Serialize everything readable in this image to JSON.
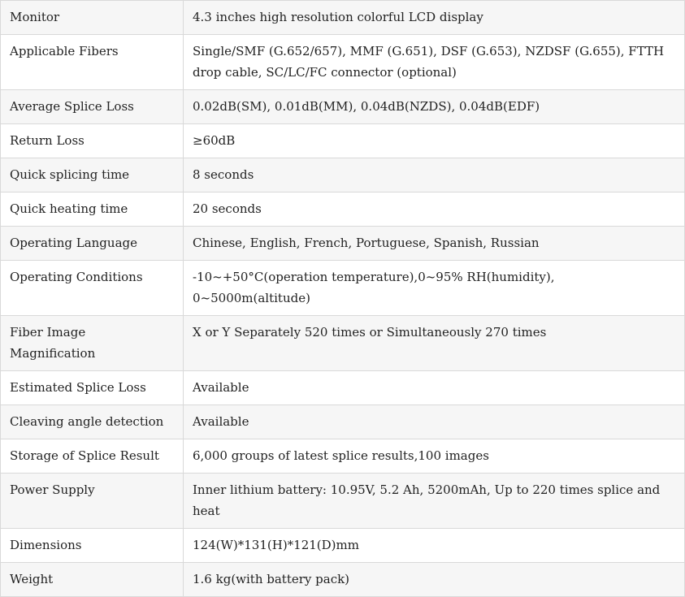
{
  "spec_table": {
    "rows": [
      {
        "label": "Monitor",
        "value": "4.3 inches high resolution colorful LCD display"
      },
      {
        "label": "Applicable Fibers",
        "value": "Single/SMF (G.652/657), MMF (G.651), DSF (G.653), NZDSF (G.655), FTTH drop cable, SC/LC/FC connector (optional)"
      },
      {
        "label": "Average Splice Loss",
        "value": "0.02dB(SM), 0.01dB(MM), 0.04dB(NZDS), 0.04dB(EDF)"
      },
      {
        "label": "Return Loss",
        "value": "≥60dB"
      },
      {
        "label": "Quick splicing time",
        "value": "8 seconds"
      },
      {
        "label": "Quick heating time",
        "value": "20 seconds"
      },
      {
        "label": "Operating Language",
        "value": "Chinese, English, French, Portuguese, Spanish, Russian"
      },
      {
        "label": "Operating Conditions",
        "value": "-10~+50°C(operation temperature),0~95% RH(humidity), 0~5000m(altitude)"
      },
      {
        "label": "Fiber Image Magnification",
        "value": "X or Y Separately 520 times or Simultaneously 270 times"
      },
      {
        "label": "Estimated Splice Loss",
        "value": "Available"
      },
      {
        "label": "Cleaving angle detection",
        "value": "Available"
      },
      {
        "label": "Storage of Splice Result",
        "value": "6,000 groups of latest splice results,100 images"
      },
      {
        "label": "Power Supply",
        "value": "Inner lithium battery: 10.95V, 5.2 Ah, 5200mAh, Up to 220 times splice and heat"
      },
      {
        "label": "Dimensions",
        "value": "124(W)*131(H)*121(D)mm"
      },
      {
        "label": "Weight",
        "value": "1.6 kg(with battery pack)"
      }
    ]
  }
}
